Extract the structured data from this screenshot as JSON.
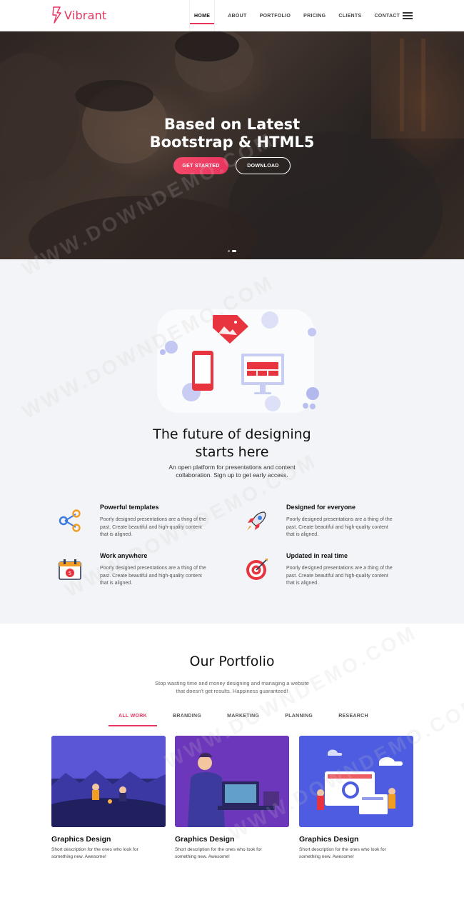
{
  "brand": {
    "name": "Vibrant",
    "accent": "#e8345e"
  },
  "nav": {
    "items": [
      {
        "label": "HOME",
        "active": true
      },
      {
        "label": "ABOUT"
      },
      {
        "label": "PORTFOLIO"
      },
      {
        "label": "PRICING"
      },
      {
        "label": "CLIENTS"
      },
      {
        "label": "CONTACT"
      }
    ],
    "menu_icon": "hamburger-icon"
  },
  "hero": {
    "title_line1": "Based on Latest",
    "title_line2": "Bootstrap & HTML5",
    "btn_primary": "GET STARTED",
    "btn_secondary": "DOWNLOAD",
    "slides_count": 2,
    "active_slide": 2
  },
  "features": {
    "title_line1": "The future of designing",
    "title_line2": "starts here",
    "subtitle_line1": "An open platform for presentations and content",
    "subtitle_line2": "collaboration. Sign up to get early access.",
    "items": [
      {
        "title": "Powerful templates",
        "desc_line1": "Poorly designed presentations are a thing of the",
        "desc_line2": "past. Create beautiful and high-quality content",
        "desc_line3": "that is aligned.",
        "icon": "share-nodes-icon"
      },
      {
        "title": "Designed for everyone",
        "desc_line1": "Poorly designed presentations are a thing of the",
        "desc_line2": "past. Create beautiful and high-quality content",
        "desc_line3": "that is aligned.",
        "icon": "rocket-icon"
      },
      {
        "title": "Work anywhere",
        "desc_line1": "Poorly designed presentations are a thing of the",
        "desc_line2": "past. Create beautiful and high-quality content",
        "desc_line3": "that is aligned.",
        "icon": "calendar-icon"
      },
      {
        "title": "Updated in real time",
        "desc_line1": "Poorly designed presentations are a thing of the",
        "desc_line2": "past. Create beautiful and high-quality content",
        "desc_line3": "that is aligned.",
        "icon": "target-icon"
      }
    ]
  },
  "portfolio": {
    "title": "Our Portfolio",
    "subtitle_line1": "Stop wasting time and money designing and managing a website",
    "subtitle_line2": "that doesn't get results. Happiness guaranteed!",
    "tabs": [
      {
        "label": "ALL WORK",
        "active": true
      },
      {
        "label": "BRANDING"
      },
      {
        "label": "MARKETING"
      },
      {
        "label": "PLANNING"
      },
      {
        "label": "RESEARCH"
      }
    ],
    "cards": [
      {
        "title": "Graphics Design",
        "desc_line1": "Short description for the ones who look for",
        "desc_line2": "something new. Awesome!"
      },
      {
        "title": "Graphics Design",
        "desc_line1": "Short description for the ones who look for",
        "desc_line2": "something new. Awesome!"
      },
      {
        "title": "Graphics Design",
        "desc_line1": "Short description for the ones who look for",
        "desc_line2": "something new. Awesome!"
      }
    ]
  },
  "watermark": "WWW.DOWNDEMO.COM"
}
